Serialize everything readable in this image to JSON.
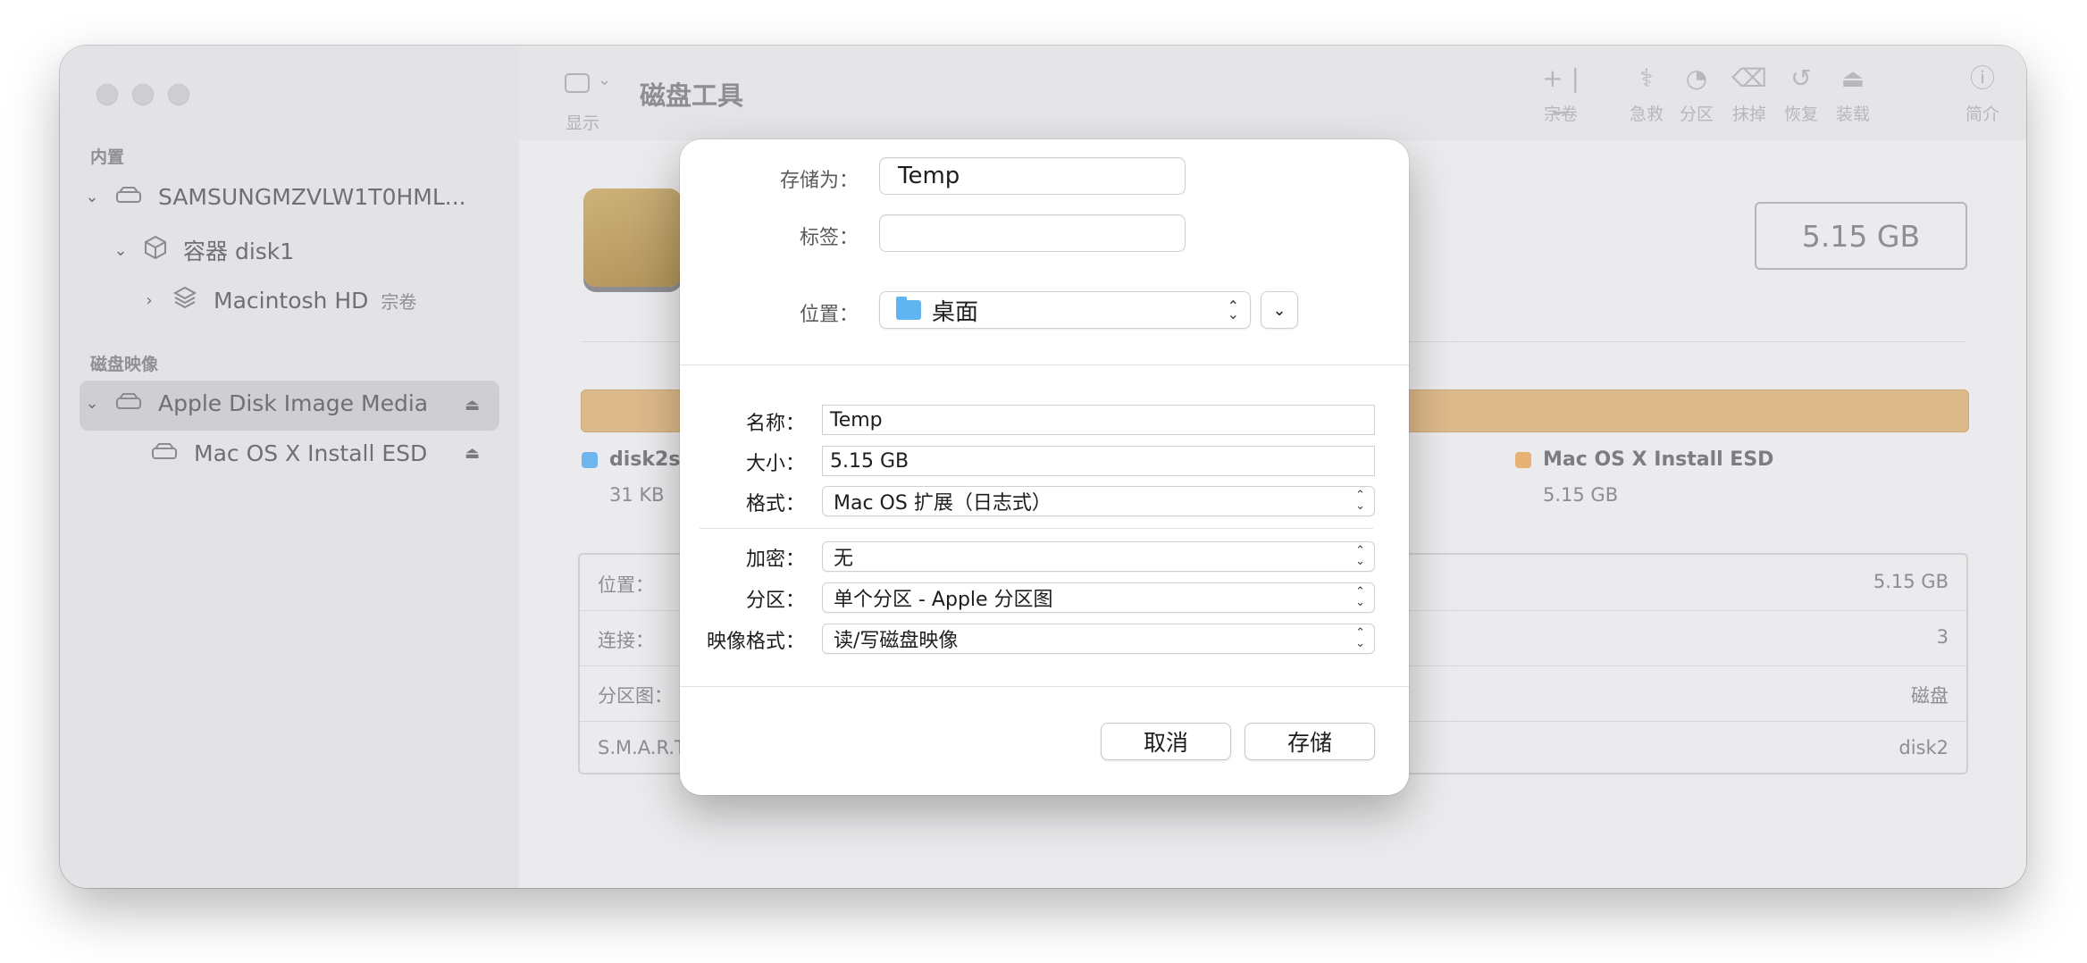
{
  "window": {
    "title": "磁盘工具",
    "toolbar_sidebar_label": "显示"
  },
  "toolbar": {
    "items": [
      {
        "icon": "plus-minus-icon",
        "glyph": "+ | −",
        "label": "宗卷"
      },
      {
        "icon": "first-aid-icon",
        "glyph": "⚕",
        "label": "急救"
      },
      {
        "icon": "partition-icon",
        "glyph": "◔",
        "label": "分区"
      },
      {
        "icon": "erase-icon",
        "glyph": "⌫",
        "label": "抹掉"
      },
      {
        "icon": "restore-icon",
        "glyph": "↺",
        "label": "恢复"
      },
      {
        "icon": "mount-icon",
        "glyph": "⏏",
        "label": "装载"
      },
      {
        "icon": "info-icon",
        "glyph": "ⓘ",
        "label": "简介"
      }
    ]
  },
  "sidebar": {
    "internal_header": "内置",
    "disk_image_header": "磁盘映像",
    "internal": [
      {
        "label": "SAMSUNGMZVLW1T0HML...",
        "icon": "internal-drive-icon"
      },
      {
        "label": "容器 disk1",
        "icon": "container-icon"
      },
      {
        "label": "Macintosh HD",
        "badge": "宗卷",
        "icon": "volume-stack-icon"
      }
    ],
    "images": [
      {
        "label": "Apple Disk Image Media",
        "icon": "disk-image-icon",
        "eject": "eject-icon"
      },
      {
        "label": "Mac OS X Install ESD",
        "icon": "disk-image-icon",
        "eject": "eject-icon"
      }
    ]
  },
  "main": {
    "size": "5.15 GB",
    "legend": [
      {
        "name": "disk2s1",
        "size": "31 KB",
        "color": "#6fb6ee"
      },
      {
        "name": "Mac OS X Install ESD",
        "size": "5.15 GB",
        "color": "#e8b276"
      }
    ],
    "info_rows": [
      {
        "label": "位置：",
        "value": "5.15 GB"
      },
      {
        "label": "连接：",
        "value": "3"
      },
      {
        "label": "分区图：",
        "value": "磁盘"
      },
      {
        "label": "S.M.A.R.T",
        "value": "disk2"
      }
    ]
  },
  "dialog": {
    "save_as_label": "存储为：",
    "save_as_value": "Temp",
    "tags_label": "标签：",
    "tags_value": "",
    "location_label": "位置：",
    "location_value": "桌面",
    "name_label": "名称：",
    "name_value": "Temp",
    "size_label": "大小：",
    "size_value": "5.15 GB",
    "format_label": "格式：",
    "format_value": "Mac OS 扩展（日志式）",
    "encryption_label": "加密：",
    "encryption_value": "无",
    "partition_label": "分区：",
    "partition_value": "单个分区 - Apple 分区图",
    "image_format_label": "映像格式：",
    "image_format_value": "读/写磁盘映像",
    "cancel_label": "取消",
    "save_label": "存储"
  }
}
